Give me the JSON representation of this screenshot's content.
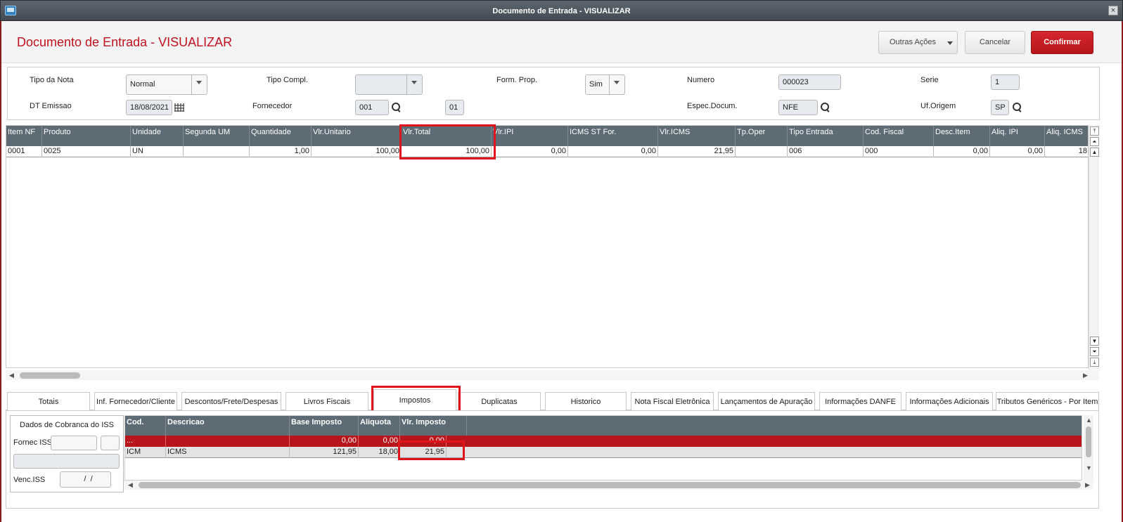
{
  "window": {
    "title": "Documento de Entrada - VISUALIZAR",
    "close": "×"
  },
  "header": {
    "title": "Documento de Entrada - VISUALIZAR",
    "buttons": {
      "more": "Outras Ações",
      "cancel": "Cancelar",
      "confirm": "Confirmar"
    }
  },
  "form": {
    "tipo_nota": {
      "label": "Tipo da Nota",
      "value": "Normal"
    },
    "tipo_compl": {
      "label": "Tipo Compl.",
      "value": ""
    },
    "form_prop": {
      "label": "Form. Prop.",
      "value": "Sim"
    },
    "numero": {
      "label": "Numero",
      "value": "000023"
    },
    "serie": {
      "label": "Serie",
      "value": "1"
    },
    "dt_emissao": {
      "label": "DT Emissao",
      "value": "18/08/2021"
    },
    "fornecedor": {
      "label": "Fornecedor",
      "value": "001",
      "loja": "01"
    },
    "espec_docum": {
      "label": "Espec.Docum.",
      "value": "NFE"
    },
    "uf_origem": {
      "label": "Uf.Origem",
      "value": "SP"
    }
  },
  "items_grid": {
    "columns": [
      "Item NF",
      "Produto",
      "Unidade",
      "Segunda UM",
      "Quantidade",
      "Vlr.Unitario",
      "Vlr.Total",
      "Vlr.IPI",
      "ICMS ST For.",
      "Vlr.ICMS",
      "Tp.Oper",
      "Tipo Entrada",
      "Cod. Fiscal",
      "Desc.Item",
      "Aliq. IPI",
      "Aliq. ICMS"
    ],
    "rows": [
      [
        "0001",
        "0025",
        "UN",
        "",
        "1,00",
        "100,00",
        "100,00",
        "0,00",
        "0,00",
        "21,95",
        "",
        "006",
        "000",
        "0,00",
        "0,00",
        "18"
      ]
    ]
  },
  "tabs": [
    "Totais",
    "Inf. Fornecedor/Cliente",
    "Descontos/Frete/Despesas",
    "Livros Fiscais",
    "Impostos",
    "Duplicatas",
    "Historico",
    "Nota Fiscal Eletrônica",
    "Lançamentos de Apuração",
    "Informações DANFE",
    "Informações Adicionais",
    "Tributos Genéricos - Por Item"
  ],
  "iss": {
    "title": "Dados de Cobranca do ISS",
    "fornec_label": "Fornec ISS",
    "venc_label": "Venc.ISS",
    "venc_value": " /  /"
  },
  "tax_grid": {
    "columns": [
      "Cod.",
      "Descricao",
      "Base Imposto",
      "Aliquota",
      "Vlr. Imposto"
    ],
    "rows": [
      [
        "...",
        "",
        "0,00",
        "0,00",
        "0,00"
      ],
      [
        "ICM",
        "ICMS",
        "121,95",
        "18,00",
        "21,95"
      ]
    ]
  },
  "colors": {
    "accent": "#c1121f",
    "header_grid": "#5d6b75",
    "highlight_row": "#b8141b"
  }
}
